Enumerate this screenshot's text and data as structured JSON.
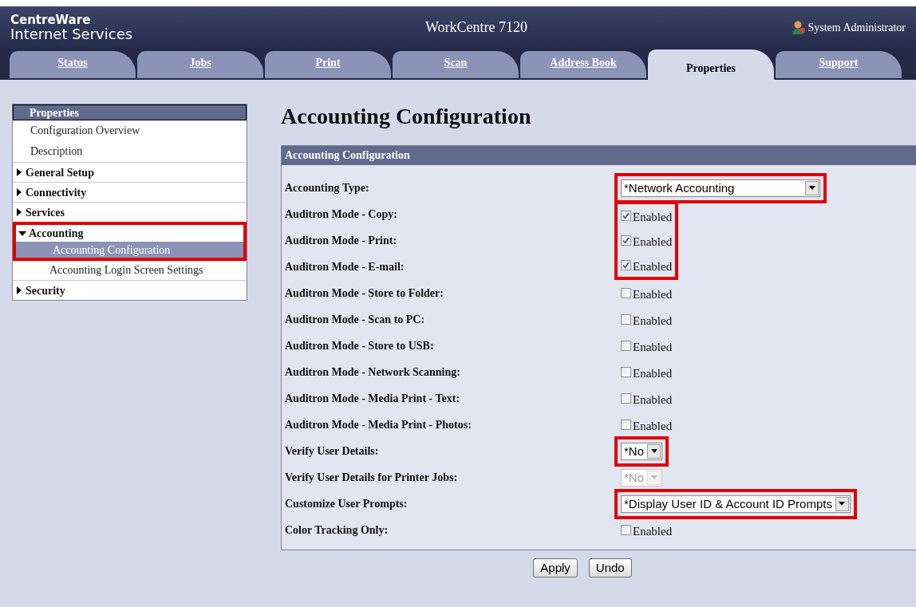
{
  "header": {
    "logo_line1": "CentreWare",
    "logo_line2": "Internet Services",
    "device": "WorkCentre 7120",
    "user": "System Administrator"
  },
  "tabs": [
    {
      "label": "Status",
      "selected": false
    },
    {
      "label": "Jobs",
      "selected": false
    },
    {
      "label": "Print",
      "selected": false
    },
    {
      "label": "Scan",
      "selected": false
    },
    {
      "label": "Address Book",
      "selected": false
    },
    {
      "label": "Properties",
      "selected": true
    },
    {
      "label": "Support",
      "selected": false
    }
  ],
  "sidebar": {
    "title": "Properties",
    "items": [
      {
        "label": "Configuration Overview",
        "kind": "link"
      },
      {
        "label": "Description",
        "kind": "link"
      },
      {
        "label": "General Setup",
        "kind": "folder",
        "expanded": false
      },
      {
        "label": "Connectivity",
        "kind": "folder",
        "expanded": false
      },
      {
        "label": "Services",
        "kind": "folder",
        "expanded": false
      },
      {
        "label": "Accounting",
        "kind": "folder",
        "expanded": true,
        "highlighted": true,
        "children": [
          {
            "label": "Accounting Configuration",
            "selected": true,
            "highlighted": true
          },
          {
            "label": "Accounting Login Screen Settings",
            "selected": false
          }
        ]
      },
      {
        "label": "Security",
        "kind": "folder",
        "expanded": false
      }
    ]
  },
  "page_title": "Accounting Configuration",
  "panel": {
    "title": "Accounting Configuration",
    "rows": [
      {
        "label": "Accounting Type:",
        "kind": "select",
        "value": "*Network Accounting",
        "disabled": false,
        "highlighted": true
      },
      {
        "label": "Auditron Mode - Copy:",
        "kind": "checkbox",
        "text": "Enabled",
        "checked": true,
        "highlighted": true
      },
      {
        "label": "Auditron Mode - Print:",
        "kind": "checkbox",
        "text": "Enabled",
        "checked": true,
        "highlighted": true
      },
      {
        "label": "Auditron Mode - E-mail:",
        "kind": "checkbox",
        "text": "Enabled",
        "checked": true,
        "highlighted": true
      },
      {
        "label": "Auditron Mode - Store to Folder:",
        "kind": "checkbox",
        "text": "Enabled",
        "checked": false,
        "highlighted": false
      },
      {
        "label": "Auditron Mode - Scan to PC:",
        "kind": "checkbox",
        "text": "Enabled",
        "checked": false,
        "highlighted": false
      },
      {
        "label": "Auditron Mode - Store to USB:",
        "kind": "checkbox",
        "text": "Enabled",
        "checked": false,
        "highlighted": false
      },
      {
        "label": "Auditron Mode - Network Scanning:",
        "kind": "checkbox",
        "text": "Enabled",
        "checked": false,
        "highlighted": false
      },
      {
        "label": "Auditron Mode - Media Print - Text:",
        "kind": "checkbox",
        "text": "Enabled",
        "checked": false,
        "highlighted": false
      },
      {
        "label": "Auditron Mode - Media Print - Photos:",
        "kind": "checkbox",
        "text": "Enabled",
        "checked": false,
        "highlighted": false
      },
      {
        "label": "Verify User Details:",
        "kind": "select",
        "value": "*No",
        "disabled": false,
        "highlighted": true
      },
      {
        "label": "Verify User Details for Printer Jobs:",
        "kind": "select",
        "value": "*No",
        "disabled": true,
        "highlighted": false
      },
      {
        "label": "Customize User Prompts:",
        "kind": "select",
        "value": "*Display User ID & Account ID Prompts",
        "disabled": false,
        "highlighted": true
      },
      {
        "label": "Color Tracking Only:",
        "kind": "checkbox",
        "text": "Enabled",
        "checked": false,
        "highlighted": false
      }
    ]
  },
  "buttons": [
    {
      "label": "Apply"
    },
    {
      "label": "Undo"
    }
  ]
}
